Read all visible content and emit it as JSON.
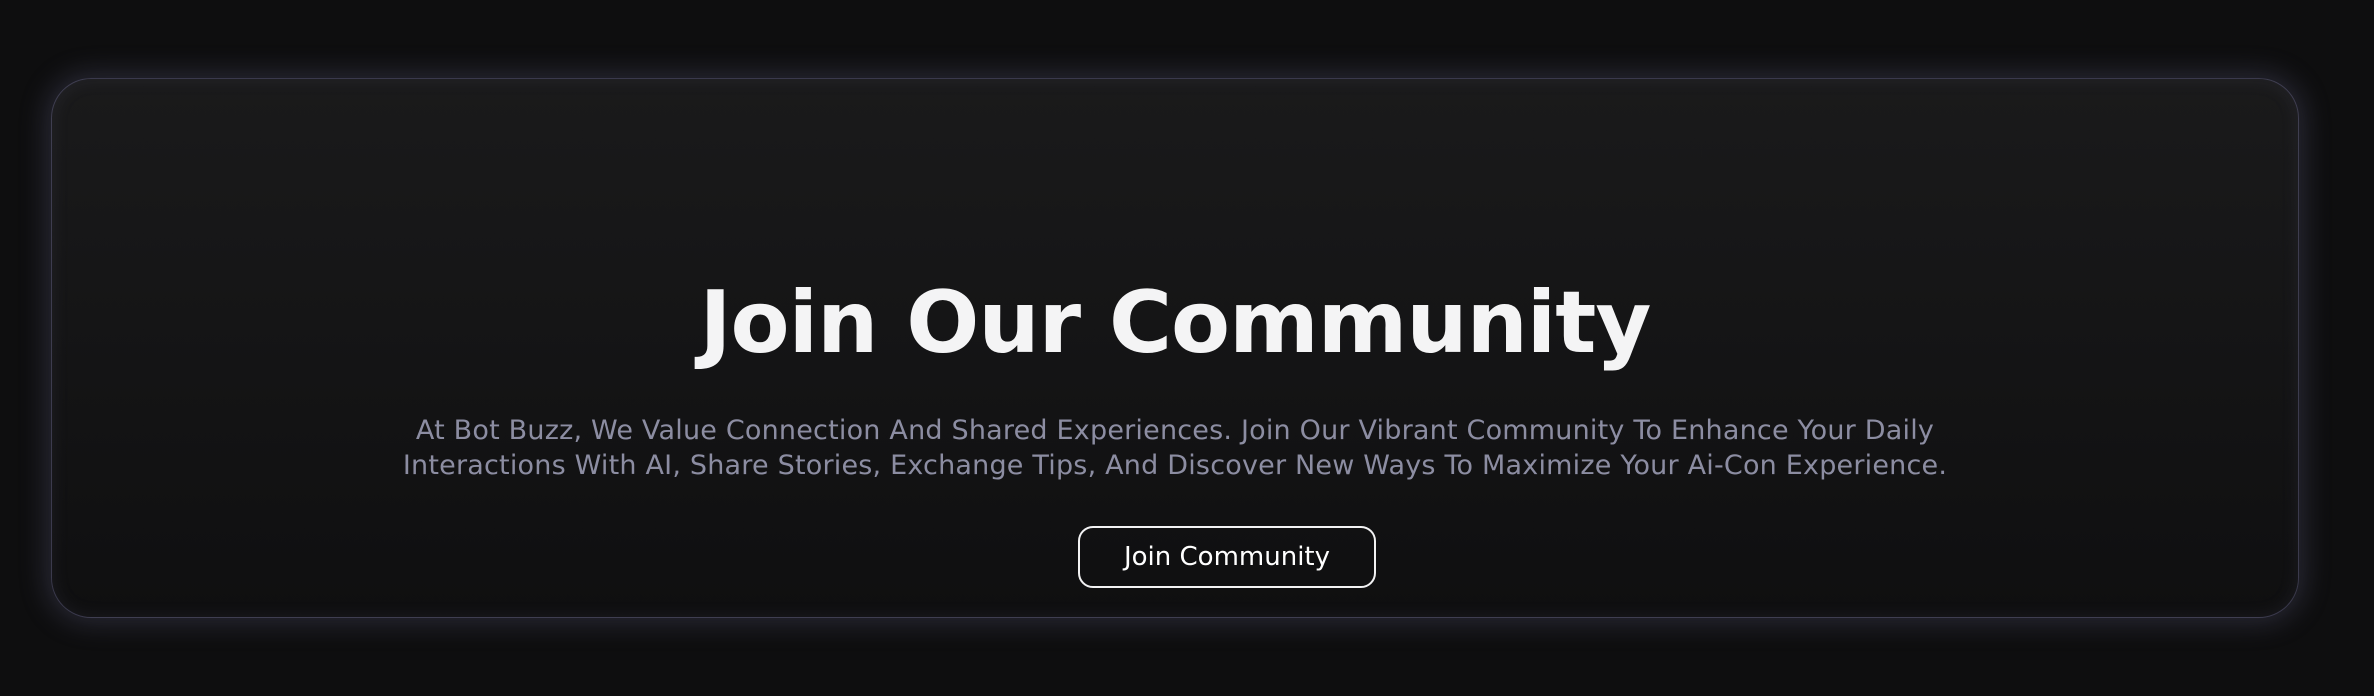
{
  "community": {
    "title": "Join Our Community",
    "description": "At Bot Buzz, We Value Connection And Shared Experiences. Join Our Vibrant Community To Enhance Your Daily Interactions With AI, Share Stories, Exchange Tips, And Discover New Ways To Maximize Your Ai-Con Experience.",
    "button_label": "Join Community"
  },
  "colors": {
    "background": "#0e0e0f",
    "card_glow": "#7876a0",
    "title": "#f4f4f5",
    "description": "#8c8da2",
    "button_border": "#f2f2f3"
  }
}
